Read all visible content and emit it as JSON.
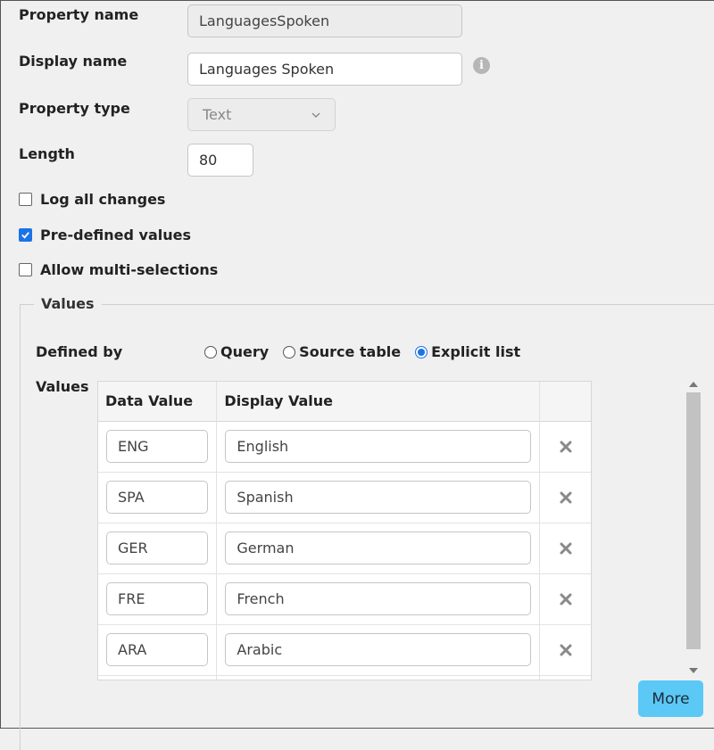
{
  "property_name": {
    "label": "Property name",
    "value": "LanguagesSpoken"
  },
  "display_name": {
    "label": "Display name",
    "value": "Languages Spoken"
  },
  "property_type": {
    "label": "Property type",
    "value": "Text"
  },
  "length": {
    "label": "Length",
    "value": "80"
  },
  "checkboxes": {
    "log_changes": {
      "label": "Log all changes",
      "checked": false
    },
    "predefined": {
      "label": "Pre-defined values",
      "checked": true
    },
    "multi": {
      "label": "Allow multi-selections",
      "checked": false
    }
  },
  "values_section": {
    "legend": "Values",
    "defined_by_label": "Defined by",
    "values_label": "Values",
    "radios": [
      {
        "label": "Query",
        "selected": false
      },
      {
        "label": "Source table",
        "selected": false
      },
      {
        "label": "Explicit list",
        "selected": true
      }
    ],
    "table": {
      "headers": [
        "Data Value",
        "Display Value",
        ""
      ],
      "rows": [
        {
          "data": "ENG",
          "display": "English"
        },
        {
          "data": "SPA",
          "display": "Spanish"
        },
        {
          "data": "GER",
          "display": "German"
        },
        {
          "data": "FRE",
          "display": "French"
        },
        {
          "data": "ARA",
          "display": "Arabic"
        }
      ]
    },
    "more_label": "More"
  },
  "colors": {
    "accent": "#1a73e8",
    "more_button": "#5bc8f5"
  },
  "icons": {
    "info": "info-icon",
    "delete": "close-icon",
    "dropdown": "chevron-down-icon"
  }
}
